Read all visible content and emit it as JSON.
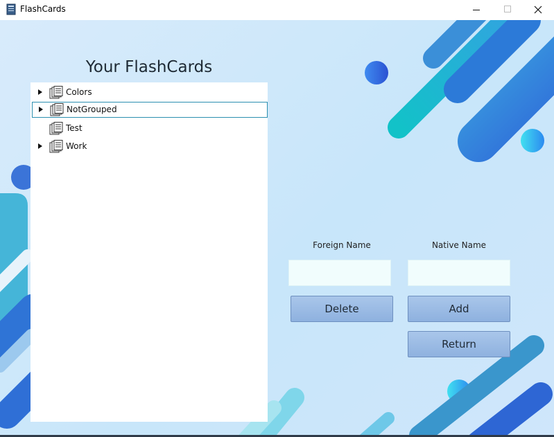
{
  "window": {
    "title": "FlashCards",
    "icons": [
      "flashcards-app-icon",
      "minimize-icon",
      "maximize-icon",
      "close-icon"
    ]
  },
  "main": {
    "heading": "Your FlashCards",
    "tree": {
      "items": [
        {
          "label": "Colors",
          "expandable": true,
          "selected": false,
          "icon": "cards-stack-icon"
        },
        {
          "label": "NotGrouped",
          "expandable": true,
          "selected": true,
          "icon": "cards-stack-icon"
        },
        {
          "label": "Test",
          "expandable": false,
          "selected": false,
          "icon": "cards-stack-icon"
        },
        {
          "label": "Work",
          "expandable": true,
          "selected": false,
          "icon": "cards-stack-icon"
        }
      ]
    },
    "form": {
      "foreign_label": "Foreign Name",
      "native_label": "Native Name",
      "foreign_value": "",
      "native_value": "",
      "delete_label": "Delete",
      "add_label": "Add",
      "return_label": "Return"
    }
  },
  "colors": {
    "background": "#c8e6fa",
    "accent_blue": "#2f7fdc",
    "accent_teal": "#19c4cf",
    "button_fill": "#9ab9e4",
    "input_fill": "#f1fdfd",
    "selection_border": "#2b8fb0"
  }
}
